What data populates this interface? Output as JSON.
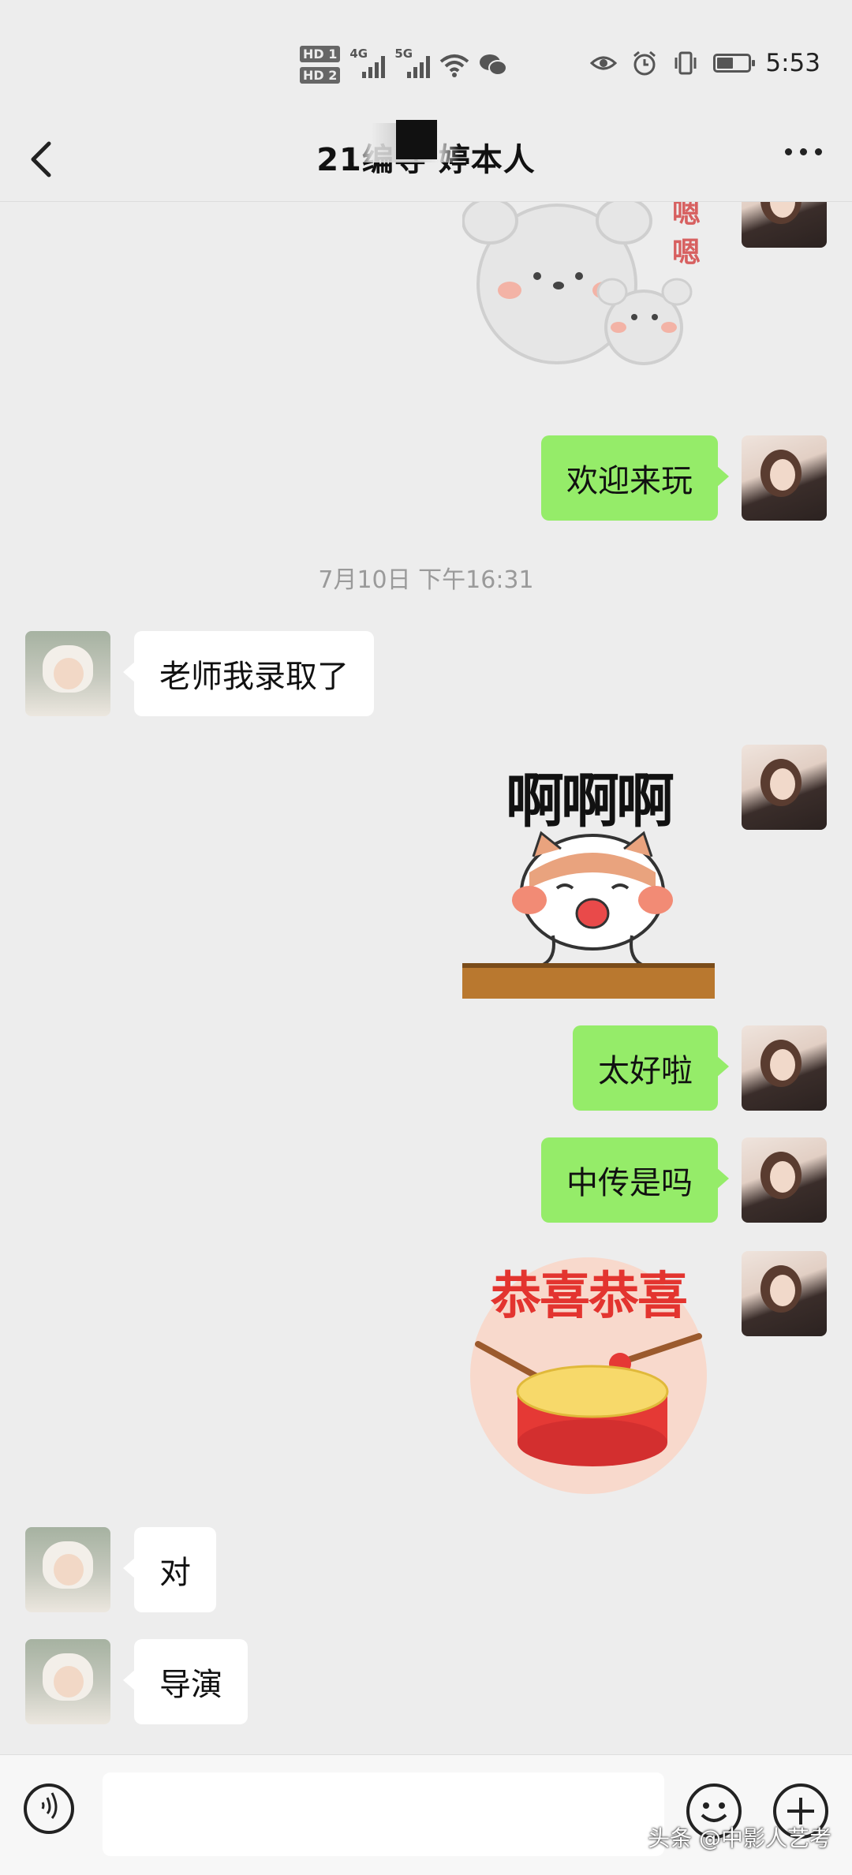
{
  "status_bar": {
    "hd1": "HD 1",
    "hd2": "HD 2",
    "net1": "4G",
    "net2": "5G",
    "time": "5:53"
  },
  "header": {
    "title": "21编导 婷本人",
    "back_icon": "chevron-left-icon",
    "more_icon": "more-dots-icon"
  },
  "messages": [
    {
      "side": "me",
      "type": "sticker",
      "text": "嗯 嗯"
    },
    {
      "side": "me",
      "type": "text",
      "text": "欢迎来玩"
    },
    {
      "side": "system",
      "type": "time",
      "text": "7月10日 下午16:31"
    },
    {
      "side": "them",
      "type": "text",
      "text": "老师我录取了"
    },
    {
      "side": "me",
      "type": "sticker",
      "text": "啊啊啊"
    },
    {
      "side": "me",
      "type": "text",
      "text": "太好啦"
    },
    {
      "side": "me",
      "type": "text",
      "text": "中传是吗"
    },
    {
      "side": "me",
      "type": "sticker",
      "text": "恭喜恭喜"
    },
    {
      "side": "them",
      "type": "text",
      "text": "对"
    },
    {
      "side": "them",
      "type": "text",
      "text": "导演"
    }
  ],
  "input_bar": {
    "voice_icon": "voice-icon",
    "emoji_icon": "emoji-icon",
    "plus_icon": "plus-icon",
    "text_value": ""
  },
  "watermark": "头条 @中影人艺考",
  "colors": {
    "background": "#ededed",
    "my_bubble": "#95ec69",
    "their_bubble": "#ffffff"
  }
}
